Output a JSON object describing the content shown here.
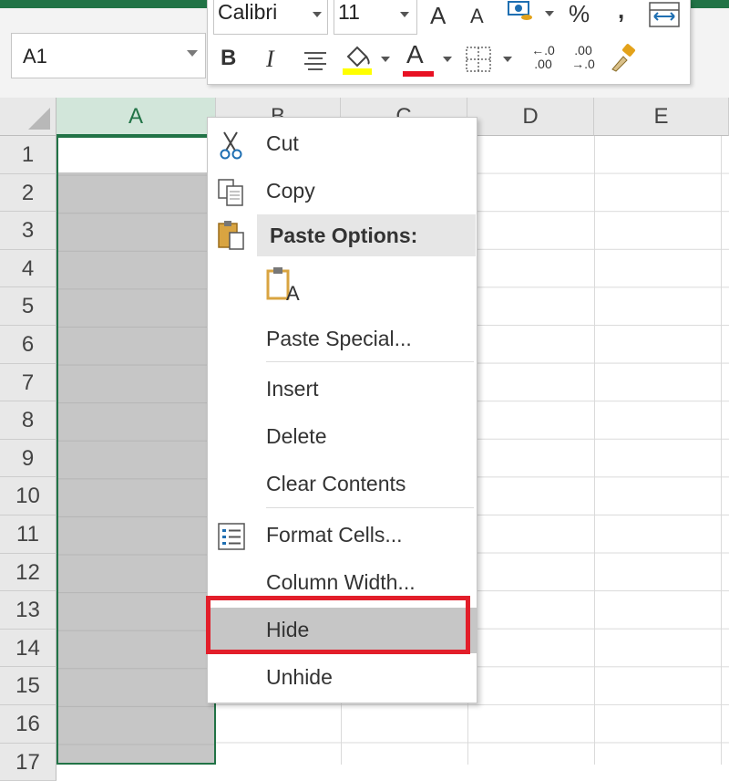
{
  "name_box": {
    "value": "A1"
  },
  "mini_toolbar": {
    "font_name": "Calibri",
    "font_size": "11",
    "grow_font": "A",
    "shrink_font": "A",
    "percent": "%",
    "comma": ",",
    "bold": "B",
    "italic": "I",
    "font_color_letter": "A",
    "dec_increase_top": "←.0",
    "dec_increase_bottom": ".00",
    "dec_decrease_top": ".00",
    "dec_decrease_bottom": "→.0"
  },
  "columns": [
    "A",
    "B",
    "C",
    "D",
    "E"
  ],
  "rows": [
    "1",
    "2",
    "3",
    "4",
    "5",
    "6",
    "7",
    "8",
    "9",
    "10",
    "11",
    "12",
    "13",
    "14",
    "15",
    "16",
    "17"
  ],
  "context_menu": {
    "cut": "Cut",
    "copy": "Copy",
    "paste_options": "Paste Options:",
    "paste_special": "Paste Special...",
    "insert": "Insert",
    "delete": "Delete",
    "clear_contents": "Clear Contents",
    "format_cells": "Format Cells...",
    "column_width": "Column Width...",
    "hide": "Hide",
    "unhide": "Unhide"
  },
  "paste_icon_letter": "A",
  "colors": {
    "excel_green": "#217346",
    "selection_gray": "#c6c6c6",
    "highlight_red": "#e21e2a",
    "fill_yellow": "#ffff00",
    "font_red": "#e81123"
  },
  "icons": [
    "scissors-icon",
    "copy-icon",
    "clipboard-icon",
    "paste-keep-text-icon",
    "format-cells-icon",
    "paint-bucket-icon",
    "borders-icon",
    "format-painter-icon",
    "accounting-format-icon",
    "wrap-text-icon"
  ]
}
